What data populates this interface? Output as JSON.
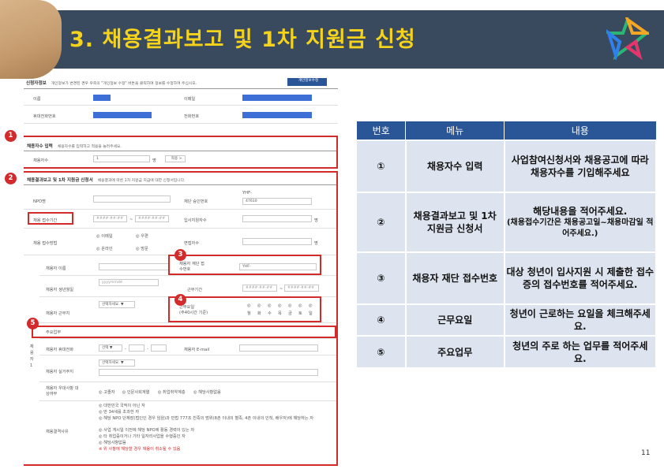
{
  "header": {
    "title": "3. 채용결과보고 및 1차 지원금 신청"
  },
  "form": {
    "applicant": {
      "section_title": "신청자정보",
      "section_note": "개인정보가 변경된 경우 우측의 \"개인정보 수정\" 버튼을 클릭하여 정보를 수정하여 주십시오.",
      "edit_button": "개인정보수정",
      "name_label": "이름",
      "email_label": "이메일",
      "mobile_label": "휴대전화번호",
      "phone_label": "전화번호"
    },
    "recruit_count": {
      "section_title": "채용자수 입력",
      "section_note": "채용자수를 입력하고 적용을 눌러주세요.",
      "label": "채용자수",
      "value": "1",
      "unit": "명",
      "apply_button": "적용 >"
    },
    "report": {
      "section_title": "채용결과보고 및 1차 지원금 신청서",
      "section_note": "채용결과에 따른 1차 지원금 지급에 대한 신청서입니다.",
      "npo_label": "NPO명",
      "foundation_no_label": "재단 승인번호",
      "foundation_no_prefix": "YHF-",
      "foundation_no_value": "47610",
      "period_label": "채용 접수기간",
      "date_placeholder": "####-##-##",
      "date_sep": "~",
      "support_count_label": "입사지원자수",
      "method_label": "채용 접수방법",
      "method_options": [
        "이메일",
        "우편",
        "온라인",
        "방문"
      ],
      "interview_label": "면접자수",
      "unit": "명"
    },
    "recruit": {
      "side_label": "채용자1",
      "name_label": "채용자 이름",
      "foundation_no_label": "채용자 재단 접수번호",
      "foundation_no_prefix": "YHF-",
      "birth_label": "채용자 생년월일",
      "birth_placeholder": "yyyymmdd",
      "work_period_label": "근무기간",
      "type_label": "채용자 근무지",
      "type_select": "선택하세요.",
      "days_label": "근무요일",
      "days_note": "(주40시간 기준)",
      "days": [
        "월",
        "화",
        "수",
        "목",
        "금",
        "토",
        "일"
      ],
      "duty_label": "주요업무",
      "mobile_label": "채용자 휴대전화",
      "mobile_select": "선택",
      "email_label": "채용자 E-mail",
      "address_label": "채용자 실거주지",
      "address_select": "선택하세요.",
      "priority_label": "채용자 우대사항 대상여부",
      "priority_options": [
        "고졸자",
        "인문사회계열",
        "취업취약계층",
        "해당사항없음"
      ],
      "eligibility_label": "채용결격사유",
      "eligibility_options": [
        "대한민국 국적이 아닌 자",
        "만 34세를 초과한 자",
        "해당 NPO 단체장(법인인 경우 임원)과 민법 777조 친족의 범위(8촌 이내의 혈족, 4촌 이내의 인척, 배우자)에 해당하는 자",
        "사업 게시일 이전에 해당 NPO에 활동 경력이 있는 자",
        "타 취업중이거나 기타 일자리사업을 수행중인 자",
        "해당사항없음",
        "위 사항에 해당할 경우 채용이 취소될 수 있음"
      ]
    },
    "badges": [
      "1",
      "2",
      "3",
      "4",
      "5"
    ]
  },
  "table": {
    "headers": [
      "번호",
      "메뉴",
      "내용"
    ],
    "rows": [
      {
        "num": "①",
        "menu": "채용자수 입력",
        "desc": "사업참여신청서와 채용공고에 따라 채용자수를 기입해주세요",
        "desc_small": ""
      },
      {
        "num": "②",
        "menu": "채용결과보고 및 1차 지원금 신청서",
        "desc": "해당내용을 적어주세요.",
        "desc_small": "(채용접수기간은 채용공고일~채용마감일 적어주세요.)"
      },
      {
        "num": "③",
        "menu": "채용자 재단 접수번호",
        "desc": "대상 청년이 입사지원 시 제출한 접수증의 접수번호를 적어주세요.",
        "desc_small": ""
      },
      {
        "num": "④",
        "menu": "근무요일",
        "desc": "청년이 근로하는 요일을 체크해주세요.",
        "desc_small": ""
      },
      {
        "num": "⑤",
        "menu": "주요업무",
        "desc": "청년의 주로 하는 업무를 적어주세요.",
        "desc_small": ""
      }
    ]
  },
  "page_number": "11",
  "colors": {
    "header_bg": "#3a4a5e",
    "title": "#f5d31a",
    "table_head": "#2a5597",
    "table_cell": "#dde4ef",
    "highlight": "#d32b2b",
    "masked": "#3d6fd6"
  }
}
